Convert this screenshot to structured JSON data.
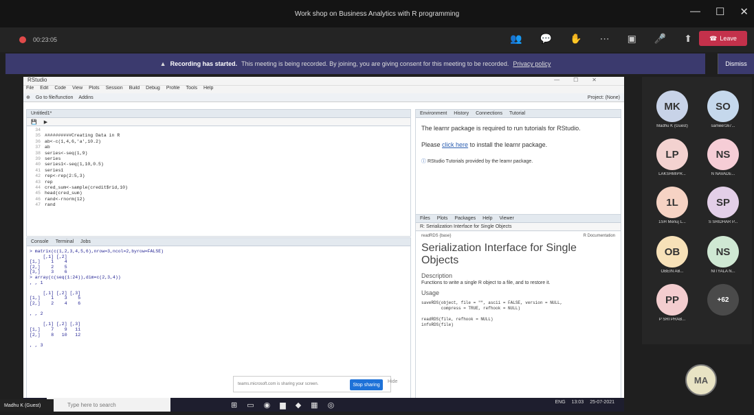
{
  "window": {
    "title": "Work shop on Business Analytics with R programming",
    "controls": [
      "—",
      "☐",
      "✕"
    ]
  },
  "toolbar": {
    "timer": "00:23:05",
    "leave_label": "Leave",
    "icons": [
      "people-icon",
      "chat-icon",
      "raise-hand-icon",
      "more-icon",
      "camera-icon",
      "mic-icon",
      "share-icon"
    ]
  },
  "banner": {
    "bold": "Recording has started.",
    "text": "This meeting is being recorded. By joining, you are giving consent for this meeting to be recorded.",
    "link": "Privacy policy",
    "dismiss": "Dismiss"
  },
  "rstudio": {
    "title": "RStudio",
    "menu": [
      "File",
      "Edit",
      "Code",
      "View",
      "Plots",
      "Session",
      "Build",
      "Debug",
      "Profile",
      "Tools",
      "Help"
    ],
    "toolbar_items": [
      "Go to file/function",
      "Addins",
      "Project: (None)"
    ],
    "editor_tabs": [
      "Untitled1*"
    ],
    "editor_lines": [
      {
        "n": "34",
        "t": ""
      },
      {
        "n": "35",
        "t": "##########Creating Data in R"
      },
      {
        "n": "36",
        "t": "ab<-c(1,4,6,'a',10.2)"
      },
      {
        "n": "37",
        "t": "ab"
      },
      {
        "n": "38",
        "t": "series<-seq(1,9)"
      },
      {
        "n": "39",
        "t": "series"
      },
      {
        "n": "40",
        "t": "series1<-seq(1,10,0.5)"
      },
      {
        "n": "41",
        "t": "series1"
      },
      {
        "n": "42",
        "t": "rep<-rep(2:5,3)"
      },
      {
        "n": "43",
        "t": "rep"
      },
      {
        "n": "44",
        "t": "cred_sum<-sample(credit$rid,10)"
      },
      {
        "n": "45",
        "t": "head(cred_sum)"
      },
      {
        "n": "46",
        "t": "rand<-rnorm(12)"
      },
      {
        "n": "47",
        "t": "rand"
      }
    ],
    "console_tabs": [
      "Console",
      "Terminal",
      "Jobs"
    ],
    "console_text": "> matrix(c(1,2,3,4,5,6),nrow=3,ncol=2,byrow=FALSE)\n     [,1] [,2]\n[1,]    1    4\n[2,]    2    5\n[3,]    3    6\n> array(c(seq(1:24)),dim=c(2,3,4))\n, , 1\n\n     [,1] [,2] [,3]\n[1,]    1    3    5\n[2,]    2    4    6\n\n, , 2\n\n     [,1] [,2] [,3]\n[1,]    7    9   11\n[2,]    8   10   12\n\n, , 3",
    "env_tabs": [
      "Environment",
      "History",
      "Connections",
      "Tutorial"
    ],
    "help_para1": "The learnr package is required to run tutorials for RStudio.",
    "help_para2_pre": "Please",
    "help_link": "click here",
    "help_para2_post": "to install the learnr package.",
    "help_para3": "RStudio Tutorials provided by the learnr package.",
    "files_tabs": [
      "Files",
      "Plots",
      "Packages",
      "Help",
      "Viewer"
    ],
    "help_topic": "R: Serialization Interface for Single Objects",
    "help_pkg": "readRDS {base}",
    "help_doc": "R Documentation",
    "help_heading": "Serialization Interface for Single Objects",
    "desc_title": "Description",
    "desc_text": "Functions to write a single R object to a file, and to restore it.",
    "usage_title": "Usage",
    "usage_code": "saveRDS(object, file = \"\", ascii = FALSE, version = NULL,\n        compress = TRUE, refhook = NULL)\n\nreadRDS(file, refhook = NULL)\ninfoRDS(file)",
    "share_text": "teams.microsoft.com is sharing your screen.",
    "stop_sharing": "Stop sharing",
    "hide": "Hide"
  },
  "taskbar": {
    "search_placeholder": "Type here to search",
    "tray_lang": "ENG",
    "tray_time": "13:03",
    "tray_date": "25-07-2021",
    "presenter": "Madhu K (Guest)"
  },
  "participants": [
    {
      "initials": "MK",
      "name": "Madhu K (Guest)",
      "color": "#c8d3e8"
    },
    {
      "initials": "SO",
      "name": "sameer167...",
      "color": "#c5d8ec"
    },
    {
      "initials": "LP",
      "name": "LAKSHMIPR...",
      "color": "#f3d2d0"
    },
    {
      "initials": "NS",
      "name": "N NAVADE...",
      "color": "#f6cdd6"
    },
    {
      "initials": "1L",
      "name": "1SH Menuj L...",
      "color": "#f6d3c4"
    },
    {
      "initials": "SP",
      "name": "S SRIDHAR P...",
      "color": "#e3cfe8"
    },
    {
      "initials": "OB",
      "name": "OBEIN AB...",
      "color": "#f7e1b8"
    },
    {
      "initials": "NS",
      "name": "NITYALA N...",
      "color": "#cfe8d3"
    },
    {
      "initials": "PP",
      "name": "P SRI PRAB...",
      "color": "#f3cdcf"
    },
    {
      "initials": "+62",
      "name": "",
      "color": "#4a4a4a"
    }
  ],
  "self": {
    "initials": "MA"
  }
}
